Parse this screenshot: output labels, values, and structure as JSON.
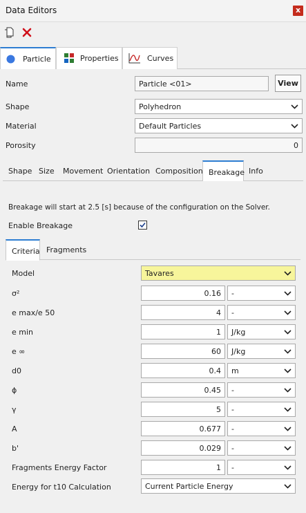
{
  "window": {
    "title": "Data Editors",
    "close_glyph": "x"
  },
  "toolbar": {
    "icons": [
      "copy-icon",
      "delete-icon"
    ]
  },
  "main_tabs": [
    {
      "label": "Particle",
      "icon": "particle-circle-icon",
      "active": true
    },
    {
      "label": "Properties",
      "icon": "properties-grid-icon",
      "active": false
    },
    {
      "label": "Curves",
      "icon": "curves-chart-icon",
      "active": false
    }
  ],
  "form": {
    "name_label": "Name",
    "name_value": "Particle <01>",
    "view_button": "View",
    "shape_label": "Shape",
    "shape_value": "Polyhedron",
    "material_label": "Material",
    "material_value": "Default Particles",
    "porosity_label": "Porosity",
    "porosity_value": "0"
  },
  "sub_tabs": [
    {
      "label": "Shape"
    },
    {
      "label": "Size"
    },
    {
      "label": "Movement"
    },
    {
      "label": "Orientation"
    },
    {
      "label": "Composition"
    },
    {
      "label": "Breakage",
      "active": true
    },
    {
      "label": "Info"
    }
  ],
  "breakage": {
    "notice": "Breakage will start at 2.5 [s] because of the configuration on the Solver.",
    "enable_label": "Enable Breakage",
    "enable_checked": true,
    "tabs": [
      {
        "label": "Criteria",
        "active": true
      },
      {
        "label": "Fragments"
      }
    ],
    "model_label": "Model",
    "model_value": "Tavares",
    "highlight_color": "#f7f59b",
    "rows": [
      {
        "label": "σ²",
        "value": "0.16",
        "unit": "-"
      },
      {
        "label": "e max/e 50",
        "value": "4",
        "unit": "-"
      },
      {
        "label": "e min",
        "value": "1",
        "unit": "J/kg"
      },
      {
        "label": "e ∞",
        "value": "60",
        "unit": "J/kg"
      },
      {
        "label": "d0",
        "value": "0.4",
        "unit": "m"
      },
      {
        "label": "ϕ",
        "value": "0.45",
        "unit": "-"
      },
      {
        "label": "γ",
        "value": "5",
        "unit": "-"
      },
      {
        "label": "A",
        "value": "0.677",
        "unit": "-"
      },
      {
        "label": "b'",
        "value": "0.029",
        "unit": "-"
      },
      {
        "label": "Fragments Energy Factor",
        "value": "1",
        "unit": "-"
      }
    ],
    "energy_label": "Energy for t10 Calculation",
    "energy_value": "Current Particle Energy"
  }
}
